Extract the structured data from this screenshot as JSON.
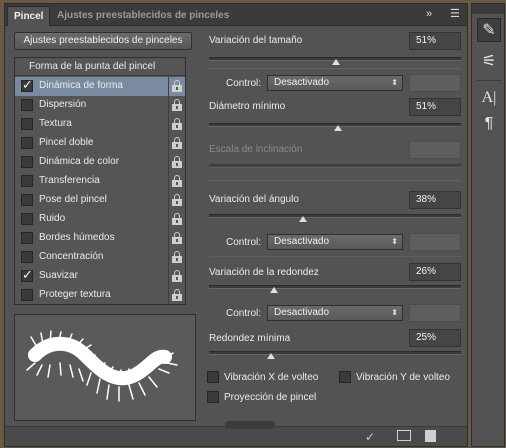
{
  "tabs": {
    "brush": "Pincel",
    "presets": "Ajustes preestablecidos de pinceles"
  },
  "presets_button": "Ajustes preestablecidos de pinceles",
  "list": {
    "header": "Forma de la punta del pincel",
    "items": [
      {
        "label": "Dinámica de forma",
        "checked": true,
        "selected": true
      },
      {
        "label": "Dispersión",
        "checked": false
      },
      {
        "label": "Textura",
        "checked": false
      },
      {
        "label": "Pincel doble",
        "checked": false
      },
      {
        "label": "Dinámica de color",
        "checked": false
      },
      {
        "label": "Transferencia",
        "checked": false
      },
      {
        "label": "Pose del pincel",
        "checked": false
      },
      {
        "label": "Ruido",
        "checked": false
      },
      {
        "label": "Bordes húmedos",
        "checked": false
      },
      {
        "label": "Concentración",
        "checked": false
      },
      {
        "label": "Suavizar",
        "checked": true
      },
      {
        "label": "Proteger textura",
        "checked": false
      }
    ]
  },
  "settings": {
    "size_jitter": {
      "label": "Variación del tamaño",
      "value": "51%",
      "level": 0.51
    },
    "control_label": "Control:",
    "control_value": "Desactivado",
    "min_diameter": {
      "label": "Diámetro mínimo",
      "value": "51%",
      "level": 0.51
    },
    "tilt_scale": {
      "label": "Escala de inclinación"
    },
    "angle_jitter": {
      "label": "Variación del ángulo",
      "value": "38%",
      "level": 0.38
    },
    "roundness_jitter": {
      "label": "Variación de la redondez",
      "value": "26%",
      "level": 0.26
    },
    "min_roundness": {
      "label": "Redondez mínima",
      "value": "25%",
      "level": 0.25
    },
    "flip_x": "Vibración X de volteo",
    "flip_y": "Vibración Y de volteo",
    "brush_projection": "Proyección de pincel"
  },
  "colors": {
    "panel": "#535353",
    "selected_row": "#7a8aa0",
    "background": "#6b5a43"
  }
}
